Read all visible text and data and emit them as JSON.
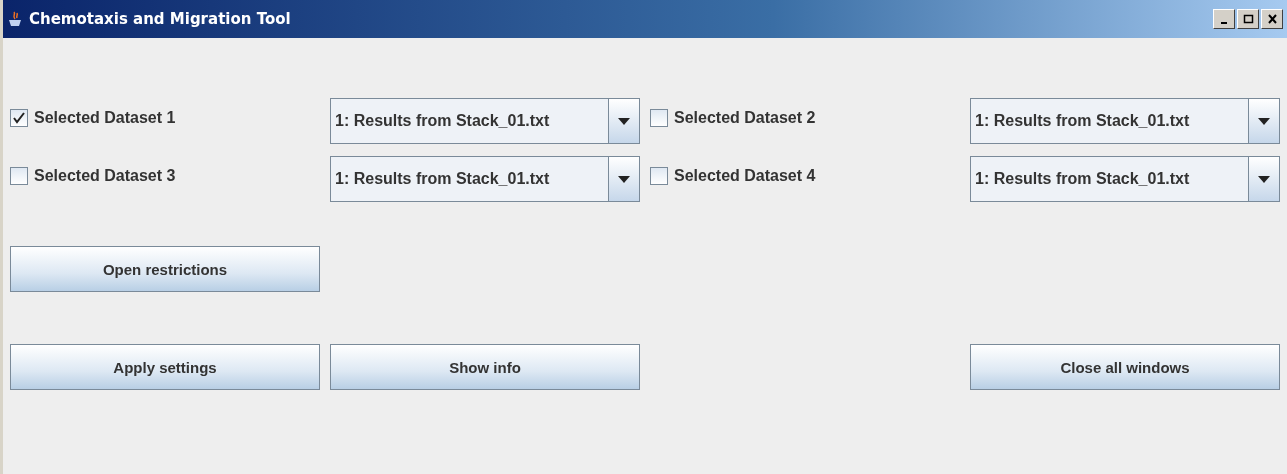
{
  "window": {
    "title": "Chemotaxis and Migration Tool"
  },
  "datasets": [
    {
      "label": "Selected Dataset 1",
      "checked": true,
      "choice": "1: Results from Stack_01.txt"
    },
    {
      "label": "Selected Dataset 2",
      "checked": false,
      "choice": "1: Results from Stack_01.txt"
    },
    {
      "label": "Selected Dataset 3",
      "checked": false,
      "choice": "1: Results from Stack_01.txt"
    },
    {
      "label": "Selected Dataset 4",
      "checked": false,
      "choice": "1: Results from Stack_01.txt"
    }
  ],
  "restrictions_button": "Open restrictions",
  "left_buttons": [
    "Apply settings",
    "Show info"
  ],
  "right_buttons": [
    "Close all windows"
  ]
}
